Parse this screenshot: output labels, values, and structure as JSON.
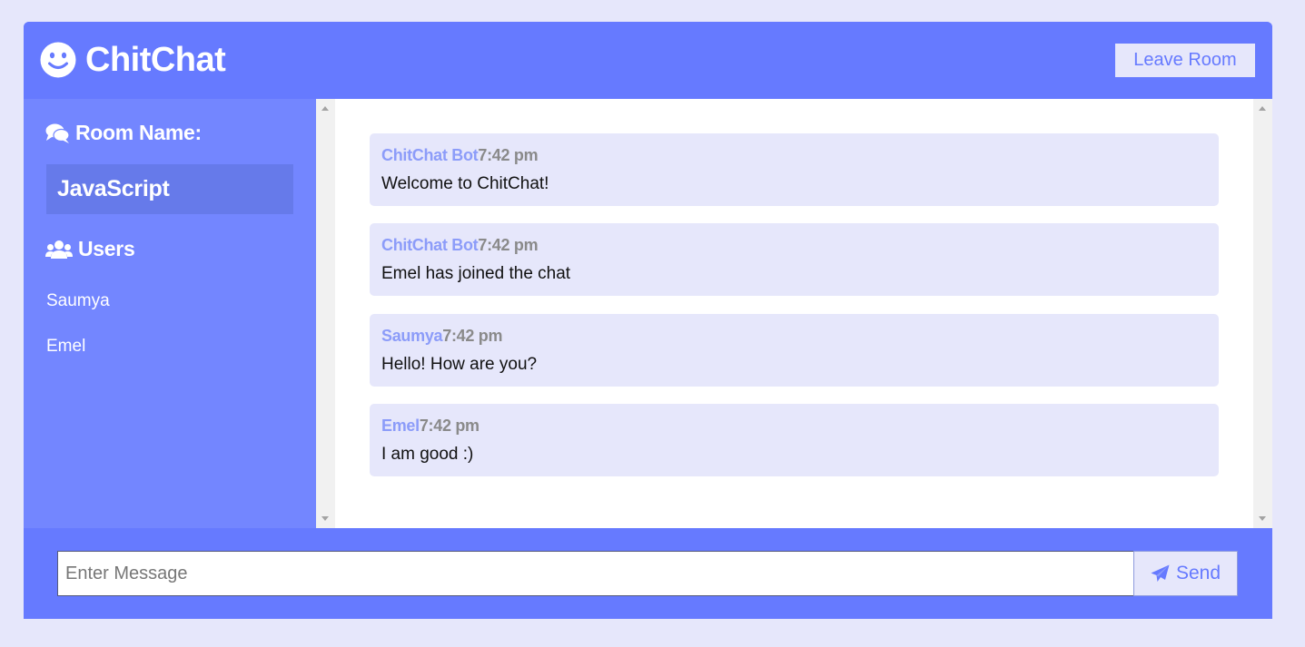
{
  "header": {
    "app_name": "ChitChat",
    "logo_icon": "smile-icon",
    "leave_label": "Leave Room"
  },
  "sidebar": {
    "room_heading": "Room Name:",
    "room_icon": "comments-icon",
    "room_name": "JavaScript",
    "users_heading": "Users",
    "users_icon": "users-icon",
    "users": [
      "Saumya",
      "Emel"
    ]
  },
  "messages": [
    {
      "user": "ChitChat Bot",
      "time": "7:42 pm",
      "text": "Welcome to ChitChat!"
    },
    {
      "user": "ChitChat Bot",
      "time": "7:42 pm",
      "text": "Emel has joined the chat"
    },
    {
      "user": "Saumya",
      "time": "7:42 pm",
      "text": "Hello! How are you?"
    },
    {
      "user": "Emel",
      "time": "7:42 pm",
      "text": "I am good :)"
    }
  ],
  "composer": {
    "placeholder": "Enter Message",
    "value": "",
    "send_label": "Send",
    "send_icon": "paper-plane-icon"
  },
  "colors": {
    "background": "#e6e7fb",
    "primary": "#667aff",
    "sidebar": "#7386ff",
    "room_highlight": "#667aea",
    "message_bg": "#e6e7fb",
    "message_user": "#8c9cf9",
    "message_time": "#8a8a8a"
  }
}
